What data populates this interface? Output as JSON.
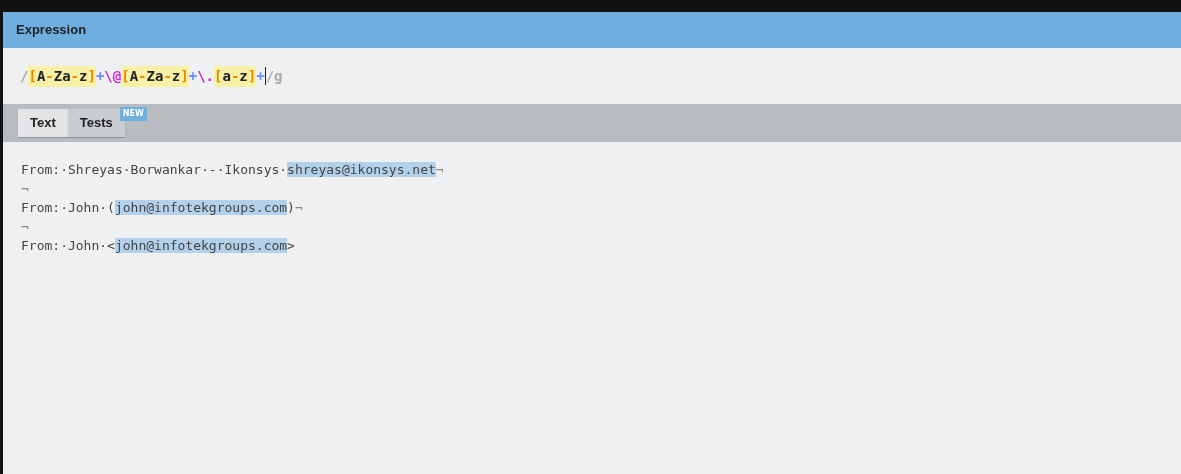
{
  "panel": {
    "title": "Expression"
  },
  "expression": [
    {
      "kind": "delimiter",
      "text": "/"
    },
    {
      "kind": "set",
      "parts": [
        {
          "kind": "bracket",
          "text": "["
        },
        {
          "kind": "char",
          "text": "A"
        },
        {
          "kind": "dash",
          "text": "-"
        },
        {
          "kind": "char",
          "text": "Za"
        },
        {
          "kind": "dash",
          "text": "-"
        },
        {
          "kind": "char",
          "text": "z"
        },
        {
          "kind": "bracket",
          "text": "]"
        }
      ]
    },
    {
      "kind": "quantifier",
      "text": "+"
    },
    {
      "kind": "escape",
      "text": "\\@"
    },
    {
      "kind": "set",
      "parts": [
        {
          "kind": "bracket",
          "text": "["
        },
        {
          "kind": "char",
          "text": "A"
        },
        {
          "kind": "dash",
          "text": "-"
        },
        {
          "kind": "char",
          "text": "Za"
        },
        {
          "kind": "dash",
          "text": "-"
        },
        {
          "kind": "char",
          "text": "z"
        },
        {
          "kind": "bracket",
          "text": "]"
        }
      ]
    },
    {
      "kind": "quantifier",
      "text": "+"
    },
    {
      "kind": "escape",
      "text": "\\."
    },
    {
      "kind": "set",
      "parts": [
        {
          "kind": "bracket",
          "text": "["
        },
        {
          "kind": "char",
          "text": "a"
        },
        {
          "kind": "dash",
          "text": "-"
        },
        {
          "kind": "char",
          "text": "z"
        },
        {
          "kind": "bracket",
          "text": "]"
        }
      ]
    },
    {
      "kind": "quantifier",
      "text": "+"
    },
    {
      "kind": "cursor"
    },
    {
      "kind": "delimiter",
      "text": "/g"
    }
  ],
  "tabs": [
    {
      "label": "Text",
      "selected": true
    },
    {
      "label": "Tests",
      "selected": false,
      "badge": "NEW"
    }
  ],
  "lines": [
    [
      {
        "kind": "plain",
        "text": "From:·Shreyas·Borwankar·-·Ikonsys·"
      },
      {
        "kind": "match",
        "text": "shreyas@ikonsys.net"
      },
      {
        "kind": "eol",
        "text": "¬"
      }
    ],
    [
      {
        "kind": "eol",
        "text": "¬"
      }
    ],
    [
      {
        "kind": "plain",
        "text": "From:·John·("
      },
      {
        "kind": "match",
        "text": "john@infotekgroups.com"
      },
      {
        "kind": "plain",
        "text": ")"
      },
      {
        "kind": "eol",
        "text": "¬"
      }
    ],
    [
      {
        "kind": "eol",
        "text": "¬"
      }
    ],
    [
      {
        "kind": "plain",
        "text": "From:·John·<"
      },
      {
        "kind": "match",
        "text": "john@infotekgroups.com"
      },
      {
        "kind": "plain",
        "text": ">"
      }
    ]
  ]
}
